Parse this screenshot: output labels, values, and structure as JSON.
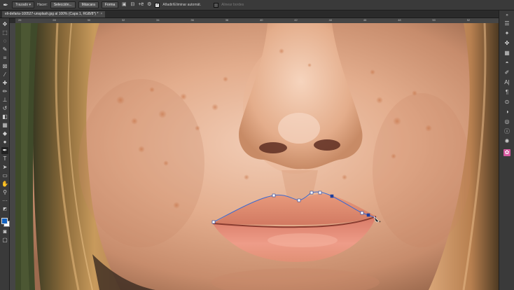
{
  "options_bar": {
    "tool_mode": "Trazado",
    "make_label": "Hacer:",
    "selection_button": "Selección...",
    "mask_button": "Máscara",
    "shape_button": "Forma",
    "auto_add_delete_label": "Añadir/Eliminar automát.",
    "auto_add_delete_checked": true,
    "align_edges_label": "Alinear bordes"
  },
  "document_tab": {
    "title": "eli-defaria-100527-unsplash.jpg al 100% (Capa 1, RGB/8*) *",
    "close": "×"
  },
  "toolbar": {
    "foreground_color": "#1564c0",
    "background_color": "#ffffff"
  },
  "ruler": {
    "top_ticks": [
      "26",
      "28",
      "30",
      "32",
      "34",
      "36",
      "38",
      "40",
      "42",
      "44",
      "46",
      "48",
      "50",
      "52"
    ]
  }
}
